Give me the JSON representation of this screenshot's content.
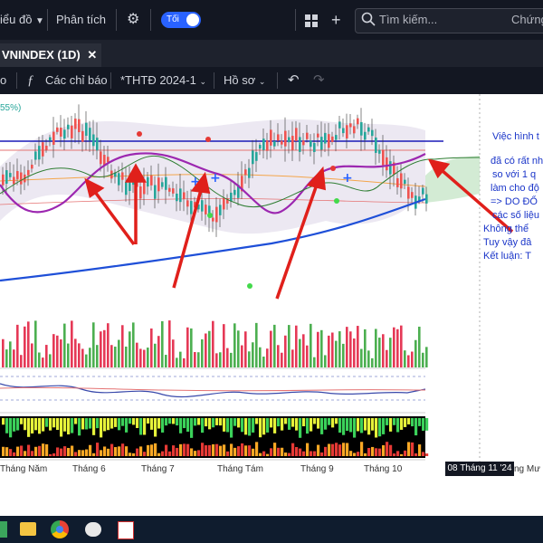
{
  "topbar": {
    "chart_menu": "iểu đồ",
    "analysis": "Phân tích",
    "theme_toggle": "Tối",
    "search_placeholder": "Tìm kiếm...",
    "right_text": "Chứng"
  },
  "tab": {
    "title": "VNINDEX (1D)"
  },
  "toolbar": {
    "indicators": "Các chỉ báo",
    "template": "*THTĐ 2024-1",
    "profile": "Hồ sơ"
  },
  "chart": {
    "percent_label": "55%)",
    "notes": [
      "Việc hình t",
      "đã có rất nh",
      "so với 1 q",
      "làm cho độ",
      "=> DO ĐỔ",
      "các số liệu",
      "Không thể",
      "Tuy vậy đâ",
      "Kết luận: T"
    ],
    "x_labels": [
      "Tháng Năm",
      "Tháng 6",
      "Tháng 7",
      "Tháng Tám",
      "Tháng 9",
      "Tháng 10",
      "ng Mư"
    ],
    "current_date": "08 Tháng 11 '24"
  },
  "colors": {
    "topbar_bg": "#131722",
    "accent": "#2962ff",
    "up": "#26a69a",
    "down": "#ef5350",
    "arrow": "#e0201b",
    "ma_purple": "#9c27b0",
    "trend_blue": "#1e4fd8",
    "resistance": "#1a1ab8"
  }
}
